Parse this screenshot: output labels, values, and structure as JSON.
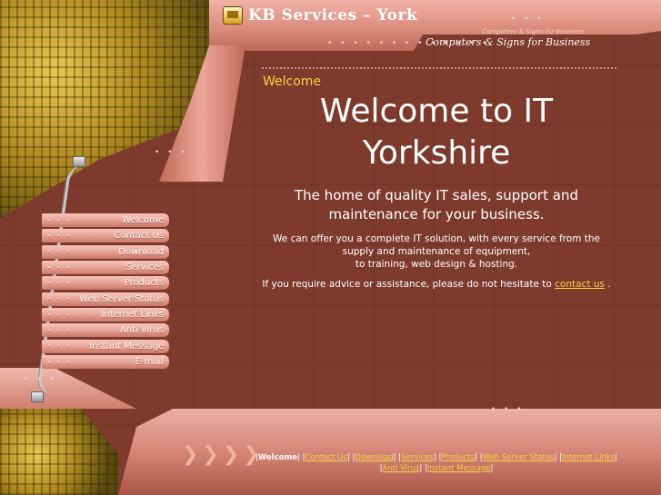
{
  "header": {
    "logo_text": "KB Services – York",
    "tagline_small": "Computers & Signs for Business",
    "tagline": "Computers & Signs for Business"
  },
  "nav": {
    "items": [
      {
        "label": "Welcome"
      },
      {
        "label": "Contact Us"
      },
      {
        "label": "Download"
      },
      {
        "label": "Services"
      },
      {
        "label": "Products"
      },
      {
        "label": "Web Server Status"
      },
      {
        "label": "Internet Links"
      },
      {
        "label": "Anti Virus"
      },
      {
        "label": "Instant Message"
      },
      {
        "label": "E-mail"
      }
    ],
    "dots": "• • •"
  },
  "main": {
    "welcome_label": "Welcome",
    "headline_line1": "Welcome to IT",
    "headline_line2": "Yorkshire",
    "subhead_line1": "The home of quality IT sales, support and",
    "subhead_line2": "maintenance for your business.",
    "para1_line1": "We can offer you a complete IT solution, with every service from the",
    "para1_line2": "supply and maintenance of equipment,",
    "para1_line3": "to training, web design & hosting.",
    "para2_prefix": "If you require advice or assistance, please do not hesitate to",
    "para2_link": "contact us",
    "para2_suffix": "."
  },
  "footer": {
    "current": "Welcome",
    "links": [
      "Contact Us",
      "Download",
      "Services",
      "Products",
      "Web Server Status",
      "Internet Links",
      "Anti Virus",
      "Instant Message"
    ]
  },
  "colors": {
    "background": "#7e3a2c",
    "accent_yellow": "#f5d442",
    "frame_pink": "#e59e90"
  },
  "decor": {
    "dots": "• • •",
    "dots_long": "• • • • • • • • • • • • •",
    "arrows": "❯❯❯❯"
  }
}
